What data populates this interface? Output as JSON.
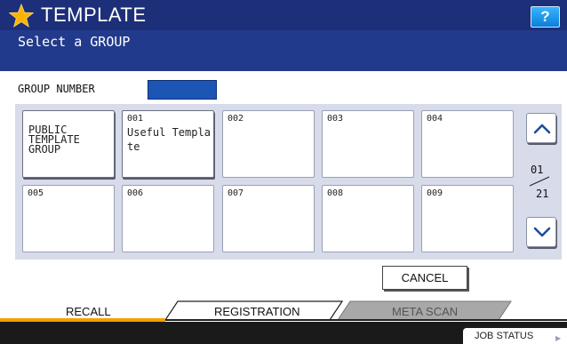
{
  "header": {
    "title": "TEMPLATE",
    "subtitle": "Select a GROUP",
    "help_label": "?",
    "icon": "star-icon"
  },
  "group_number": {
    "label": "GROUP NUMBER",
    "value": ""
  },
  "grid": {
    "public_group": {
      "label_line1": "PUBLIC",
      "label_line2": "TEMPLATE",
      "label_line3": "GROUP"
    },
    "cells": [
      {
        "number": "001",
        "name": "Useful Template"
      },
      {
        "number": "002",
        "name": ""
      },
      {
        "number": "003",
        "name": ""
      },
      {
        "number": "004",
        "name": ""
      },
      {
        "number": "005",
        "name": ""
      },
      {
        "number": "006",
        "name": ""
      },
      {
        "number": "007",
        "name": ""
      },
      {
        "number": "008",
        "name": ""
      },
      {
        "number": "009",
        "name": ""
      }
    ]
  },
  "pagination": {
    "current": "01",
    "total": "21",
    "up_icon": "chevron-up-icon",
    "down_icon": "chevron-down-icon"
  },
  "actions": {
    "cancel_label": "CANCEL"
  },
  "tabs": [
    {
      "label": "RECALL",
      "state": "active"
    },
    {
      "label": "REGISTRATION",
      "state": "normal"
    },
    {
      "label": "META SCAN",
      "state": "disabled"
    }
  ],
  "footer": {
    "job_status_label": "JOB STATUS"
  },
  "colors": {
    "header_bg": "#223a8c",
    "title_bar_bg": "#1c2f78",
    "accent_orange": "#f6a000",
    "group_field": "#1d55b5",
    "panel_bg": "#d7dbea",
    "help_blue": "#0a7fd9"
  }
}
